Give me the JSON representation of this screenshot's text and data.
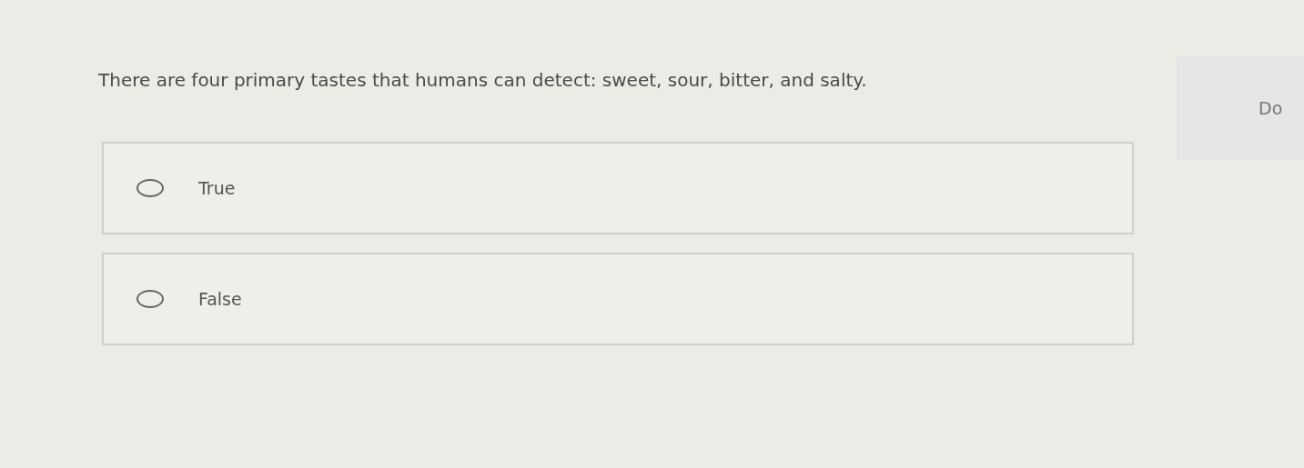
{
  "question": "There are four primary tastes that humans can detect: sweet, sour, bitter, and salty.",
  "options": [
    {
      "label": "True",
      "selected": false
    },
    {
      "label": "False",
      "selected": false
    }
  ],
  "side_panel": {
    "text": "Do"
  }
}
